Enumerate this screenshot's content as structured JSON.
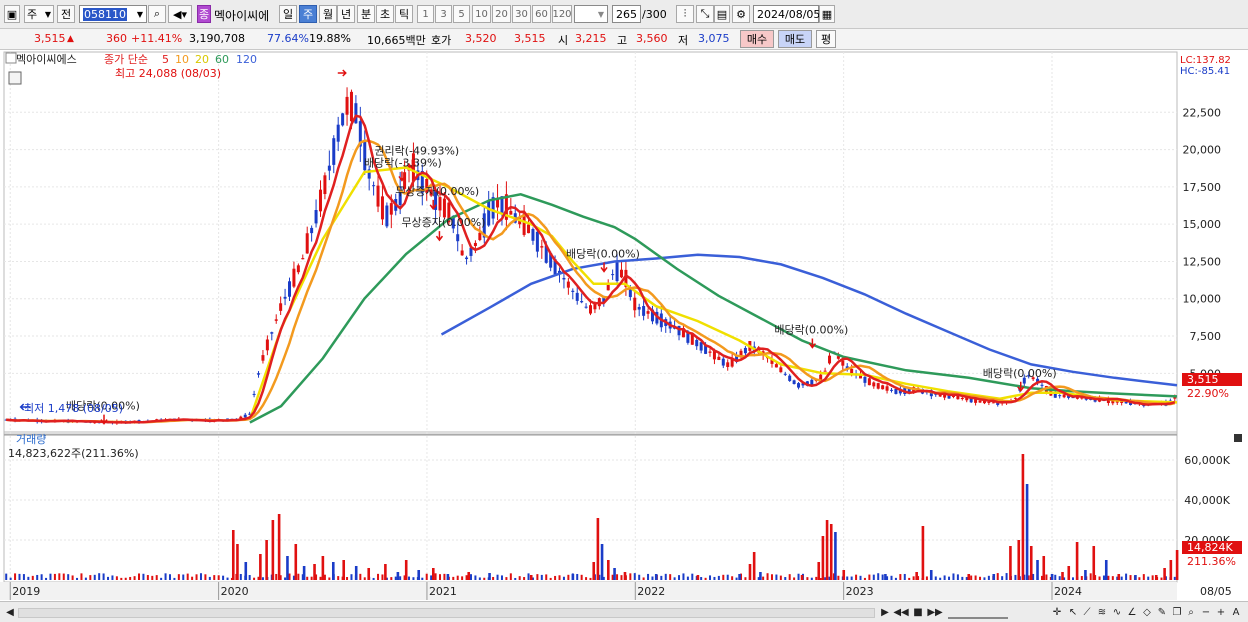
{
  "toolbar": {
    "market": "주",
    "period_label": "전",
    "code": "058110",
    "name_badge": "종",
    "stock_name": "멕아이씨에",
    "period_tabs": [
      "일",
      "주",
      "월",
      "년",
      "분",
      "초",
      "틱"
    ],
    "selected_period": "주",
    "interval_buttons": [
      "1",
      "3",
      "5",
      "10",
      "20",
      "30",
      "60",
      "120"
    ],
    "count": "265",
    "count_max": "/300",
    "date": "2024/08/05"
  },
  "quote": {
    "price": "3,515",
    "change": "360",
    "change_pct": "+11.41%",
    "volume": "3,190,708",
    "ratio1": "77.64%",
    "ratio2": "19.88%",
    "amount": "10,665백만",
    "bid_label": "호가",
    "bid": "3,520",
    "ask": "3,515",
    "open_label": "시",
    "open": "3,215",
    "high_label": "고",
    "high": "3,560",
    "low_label": "저",
    "low": "3,075",
    "buy_button": "매수",
    "sell_button": "매도",
    "eval_button": "평"
  },
  "chart_data": {
    "type": "candlestick",
    "title": "멕아이씨에스",
    "indicator_label": "종가 단순",
    "ma_periods": [
      "5",
      "10",
      "20",
      "60",
      "120"
    ],
    "ma_colors": {
      "5": "#e02020",
      "10": "#f39a1e",
      "20": "#f0e000",
      "60": "#2e9a5a",
      "120": "#3a5fd8"
    },
    "high_note": "최고 24,088 (08/03)",
    "low_note": "최저 1,478 (08/05)",
    "lc_label": "LC:137.82",
    "hc_label": "HC:-85.41",
    "y_ticks": [
      22500,
      20000,
      17500,
      15000,
      12500,
      10000,
      7500,
      5000
    ],
    "y_tick_labels": [
      "22,500",
      "20,000",
      "17,500",
      "15,000",
      "12,500",
      "10,000",
      "7,500",
      "5,000"
    ],
    "y_range": [
      1200,
      24800
    ],
    "current_price_label": "3,515",
    "current_pct_label": "22.90%",
    "x_labels": [
      "2019",
      "2020",
      "2021",
      "2022",
      "2023",
      "2024",
      "08/05"
    ],
    "x_label_dates": [
      2019.0,
      2020.0,
      2021.0,
      2022.0,
      2023.0,
      2024.0,
      2024.6
    ],
    "x_range": [
      2018.97,
      2024.6
    ],
    "events": [
      {
        "text": "배당락(0.00%)",
        "t": 2019.45,
        "price": 2300
      },
      {
        "text": "권리락(-49.93%)",
        "t": 2020.93,
        "price": 19400
      },
      {
        "text": "배당락(-3.39%)",
        "t": 2020.88,
        "price": 18600
      },
      {
        "text": "무상증자(0.00%)",
        "t": 2021.03,
        "price": 16700
      },
      {
        "text": "무상증자(0.00%)",
        "t": 2021.06,
        "price": 14600
      },
      {
        "text": "배당락(0.00%)",
        "t": 2021.85,
        "price": 12500
      },
      {
        "text": "배당락(0.00%)",
        "t": 2022.85,
        "price": 7400
      },
      {
        "text": "배당락(0.00%)",
        "t": 2023.85,
        "price": 4500
      }
    ],
    "price_path": [
      [
        2018.97,
        1900
      ],
      [
        2019.2,
        1800
      ],
      [
        2019.5,
        1700
      ],
      [
        2019.8,
        1900
      ],
      [
        2020.0,
        1850
      ],
      [
        2020.1,
        1950
      ],
      [
        2020.15,
        2300
      ],
      [
        2020.2,
        5500
      ],
      [
        2020.3,
        9500
      ],
      [
        2020.4,
        12500
      ],
      [
        2020.5,
        17000
      ],
      [
        2020.58,
        21500
      ],
      [
        2020.62,
        23000
      ],
      [
        2020.66,
        22500
      ],
      [
        2020.72,
        18500
      ],
      [
        2020.8,
        15500
      ],
      [
        2020.86,
        16500
      ],
      [
        2020.92,
        19000
      ],
      [
        2021.0,
        17500
      ],
      [
        2021.05,
        16500
      ],
      [
        2021.12,
        15500
      ],
      [
        2021.18,
        12500
      ],
      [
        2021.25,
        14000
      ],
      [
        2021.3,
        16000
      ],
      [
        2021.35,
        16500
      ],
      [
        2021.42,
        15500
      ],
      [
        2021.5,
        14500
      ],
      [
        2021.6,
        12500
      ],
      [
        2021.7,
        10500
      ],
      [
        2021.78,
        9200
      ],
      [
        2021.85,
        10000
      ],
      [
        2021.9,
        12000
      ],
      [
        2021.95,
        11500
      ],
      [
        2022.0,
        9500
      ],
      [
        2022.1,
        8800
      ],
      [
        2022.2,
        8000
      ],
      [
        2022.3,
        7000
      ],
      [
        2022.4,
        6000
      ],
      [
        2022.45,
        5500
      ],
      [
        2022.5,
        6200
      ],
      [
        2022.55,
        6800
      ],
      [
        2022.6,
        6500
      ],
      [
        2022.7,
        5200
      ],
      [
        2022.78,
        4200
      ],
      [
        2022.85,
        4400
      ],
      [
        2022.9,
        4800
      ],
      [
        2022.95,
        6500
      ],
      [
        2023.0,
        5600
      ],
      [
        2023.05,
        5000
      ],
      [
        2023.15,
        4200
      ],
      [
        2023.25,
        3800
      ],
      [
        2023.35,
        3900
      ],
      [
        2023.45,
        3600
      ],
      [
        2023.55,
        3400
      ],
      [
        2023.65,
        3100
      ],
      [
        2023.75,
        3000
      ],
      [
        2023.82,
        3200
      ],
      [
        2023.88,
        4900
      ],
      [
        2023.93,
        4500
      ],
      [
        2024.0,
        3600
      ],
      [
        2024.1,
        3400
      ],
      [
        2024.2,
        3300
      ],
      [
        2024.3,
        3100
      ],
      [
        2024.4,
        3000
      ],
      [
        2024.5,
        2950
      ],
      [
        2024.56,
        3000
      ],
      [
        2024.6,
        3515
      ]
    ],
    "ma20_path": [
      [
        2020.15,
        1900
      ],
      [
        2020.3,
        8000
      ],
      [
        2020.5,
        14000
      ],
      [
        2020.7,
        18500
      ],
      [
        2020.9,
        18800
      ],
      [
        2021.1,
        17500
      ],
      [
        2021.3,
        16000
      ],
      [
        2021.5,
        15000
      ],
      [
        2021.6,
        14200
      ],
      [
        2021.7,
        12500
      ],
      [
        2021.8,
        11000
      ],
      [
        2021.95,
        11000
      ],
      [
        2022.1,
        9500
      ],
      [
        2022.3,
        8500
      ],
      [
        2022.5,
        7200
      ],
      [
        2022.7,
        5600
      ],
      [
        2022.9,
        5000
      ],
      [
        2023.1,
        4900
      ],
      [
        2023.3,
        4300
      ],
      [
        2023.5,
        3800
      ],
      [
        2023.75,
        3300
      ],
      [
        2023.9,
        3700
      ],
      [
        2024.05,
        3700
      ],
      [
        2024.3,
        3200
      ],
      [
        2024.6,
        3050
      ]
    ],
    "ma60_path": [
      [
        2020.15,
        1700
      ],
      [
        2020.3,
        2800
      ],
      [
        2020.5,
        6000
      ],
      [
        2020.7,
        10000
      ],
      [
        2020.9,
        13000
      ],
      [
        2021.1,
        15300
      ],
      [
        2021.3,
        16600
      ],
      [
        2021.45,
        17000
      ],
      [
        2021.6,
        16300
      ],
      [
        2021.75,
        15500
      ],
      [
        2021.9,
        14800
      ],
      [
        2022.0,
        14000
      ],
      [
        2022.2,
        12000
      ],
      [
        2022.4,
        10200
      ],
      [
        2022.6,
        8700
      ],
      [
        2022.8,
        7200
      ],
      [
        2023.0,
        6100
      ],
      [
        2023.3,
        5200
      ],
      [
        2023.6,
        4700
      ],
      [
        2023.9,
        4000
      ],
      [
        2024.1,
        3800
      ],
      [
        2024.3,
        3650
      ],
      [
        2024.6,
        3450
      ]
    ],
    "ma120_path": [
      [
        2021.07,
        7600
      ],
      [
        2021.3,
        9400
      ],
      [
        2021.5,
        11000
      ],
      [
        2021.7,
        12000
      ],
      [
        2021.9,
        12500
      ],
      [
        2022.1,
        12700
      ],
      [
        2022.3,
        12950
      ],
      [
        2022.5,
        12800
      ],
      [
        2022.7,
        12300
      ],
      [
        2022.9,
        11400
      ],
      [
        2023.1,
        10300
      ],
      [
        2023.3,
        9000
      ],
      [
        2023.5,
        7800
      ],
      [
        2023.7,
        6600
      ],
      [
        2023.9,
        5600
      ],
      [
        2024.1,
        5100
      ],
      [
        2024.3,
        4700
      ],
      [
        2024.6,
        4200
      ]
    ],
    "volume_label": "거래량",
    "volume_value": "14,823,622주(211.36%)",
    "volume_ticks": [
      "60,000K",
      "40,000K",
      "20,000K"
    ],
    "volume_tick_values": [
      60000,
      40000,
      20000
    ],
    "volume_max": 66000,
    "volume_current_label": "14,824K",
    "volume_current_pct": "211.36%",
    "volume_spikes": [
      [
        2020.07,
        25000,
        "r"
      ],
      [
        2020.09,
        18000,
        "r"
      ],
      [
        2020.13,
        9000,
        "b"
      ],
      [
        2020.2,
        13000,
        "r"
      ],
      [
        2020.23,
        20000,
        "r"
      ],
      [
        2020.26,
        30000,
        "r"
      ],
      [
        2020.29,
        33000,
        "r"
      ],
      [
        2020.33,
        12000,
        "b"
      ],
      [
        2020.37,
        18000,
        "r"
      ],
      [
        2020.41,
        7000,
        "b"
      ],
      [
        2020.46,
        8000,
        "r"
      ],
      [
        2020.5,
        12000,
        "r"
      ],
      [
        2020.55,
        9000,
        "b"
      ],
      [
        2020.6,
        10000,
        "r"
      ],
      [
        2020.66,
        7000,
        "b"
      ],
      [
        2020.72,
        6000,
        "r"
      ],
      [
        2020.8,
        8000,
        "r"
      ],
      [
        2020.86,
        4000,
        "b"
      ],
      [
        2020.9,
        10000,
        "r"
      ],
      [
        2020.96,
        5000,
        "b"
      ],
      [
        2021.03,
        6000,
        "r"
      ],
      [
        2021.1,
        3000,
        "b"
      ],
      [
        2021.2,
        4000,
        "r"
      ],
      [
        2021.3,
        3500,
        "b"
      ],
      [
        2021.5,
        2500,
        "r"
      ],
      [
        2021.7,
        3000,
        "b"
      ],
      [
        2021.8,
        9000,
        "r"
      ],
      [
        2021.82,
        31000,
        "r"
      ],
      [
        2021.84,
        18000,
        "b"
      ],
      [
        2021.87,
        10000,
        "r"
      ],
      [
        2021.9,
        6000,
        "b"
      ],
      [
        2021.95,
        4000,
        "r"
      ],
      [
        2022.1,
        3000,
        "b"
      ],
      [
        2022.3,
        2500,
        "r"
      ],
      [
        2022.5,
        3000,
        "b"
      ],
      [
        2022.55,
        8000,
        "r"
      ],
      [
        2022.57,
        14000,
        "r"
      ],
      [
        2022.6,
        4000,
        "b"
      ],
      [
        2022.8,
        2500,
        "r"
      ],
      [
        2022.88,
        9000,
        "r"
      ],
      [
        2022.9,
        22000,
        "r"
      ],
      [
        2022.92,
        30000,
        "r"
      ],
      [
        2022.94,
        28000,
        "r"
      ],
      [
        2022.96,
        24000,
        "b"
      ],
      [
        2023.0,
        5000,
        "r"
      ],
      [
        2023.2,
        3000,
        "b"
      ],
      [
        2023.35,
        4000,
        "r"
      ],
      [
        2023.38,
        27000,
        "r"
      ],
      [
        2023.42,
        5000,
        "b"
      ],
      [
        2023.6,
        3000,
        "r"
      ],
      [
        2023.72,
        3000,
        "b"
      ],
      [
        2023.8,
        17000,
        "r"
      ],
      [
        2023.84,
        20000,
        "r"
      ],
      [
        2023.86,
        63000,
        "r"
      ],
      [
        2023.88,
        48000,
        "b"
      ],
      [
        2023.9,
        17000,
        "r"
      ],
      [
        2023.93,
        10000,
        "b"
      ],
      [
        2023.96,
        12000,
        "r"
      ],
      [
        2024.0,
        3000,
        "b"
      ],
      [
        2024.05,
        4000,
        "r"
      ],
      [
        2024.08,
        7000,
        "r"
      ],
      [
        2024.12,
        19000,
        "r"
      ],
      [
        2024.16,
        5000,
        "b"
      ],
      [
        2024.2,
        17000,
        "r"
      ],
      [
        2024.26,
        10000,
        "b"
      ],
      [
        2024.32,
        3000,
        "r"
      ],
      [
        2024.4,
        2500,
        "b"
      ],
      [
        2024.5,
        2500,
        "r"
      ],
      [
        2024.54,
        6000,
        "r"
      ],
      [
        2024.57,
        10000,
        "r"
      ],
      [
        2024.6,
        15000,
        "r"
      ]
    ]
  },
  "colors": {
    "up": "#e01010",
    "down": "#1a3cc8",
    "grid": "#e6e6e6"
  }
}
